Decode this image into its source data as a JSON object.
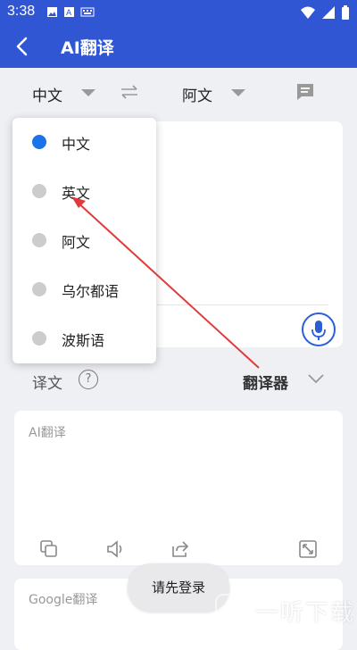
{
  "status_bar": {
    "time": "3:38",
    "icons": [
      "image-icon",
      "font-icon",
      "keyboard-icon",
      "wifi-icon",
      "signal-icon",
      "battery-icon"
    ]
  },
  "app_bar": {
    "title": "AI翻译",
    "icon": "back-arrow-icon"
  },
  "language_bar": {
    "source": "中文",
    "target": "阿文",
    "swap_icon": "swap-icon",
    "chat_icon": "chat-icon"
  },
  "dropdown": {
    "options": [
      {
        "label": "中文",
        "selected": true
      },
      {
        "label": "英文",
        "selected": false
      },
      {
        "label": "阿文",
        "selected": false
      },
      {
        "label": "乌尔都语",
        "selected": false
      },
      {
        "label": "波斯语",
        "selected": false
      }
    ]
  },
  "translation_row": {
    "label": "译文",
    "help_icon": "help-icon",
    "engine": "翻译器",
    "chevron_icon": "chevron-down-icon"
  },
  "ai_card": {
    "placeholder": "AI翻译",
    "tools": [
      "copy-icon",
      "speaker-icon",
      "share-icon",
      "expand-icon"
    ]
  },
  "google_card": {
    "placeholder": "Google翻译"
  },
  "toast": {
    "text": "请先登录"
  },
  "watermark": {
    "text": "一听下载"
  },
  "colors": {
    "primary": "#3056d3",
    "selected_dot": "#1a73e8",
    "annotation_arrow": "#e03b3b"
  }
}
